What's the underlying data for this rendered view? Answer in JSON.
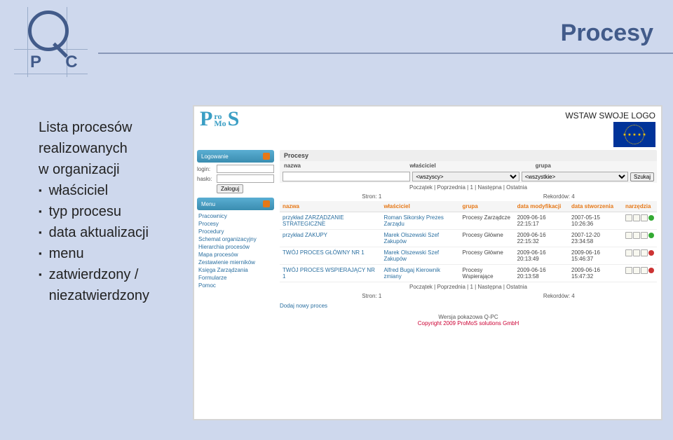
{
  "page": {
    "title": "Procesy",
    "logo_letters": "P C"
  },
  "sidebar": {
    "heading_line1": "Lista procesów",
    "heading_line2": "realizowanych",
    "heading_line3": "w organizacji",
    "items": [
      {
        "label": "właściciel"
      },
      {
        "label": "typ procesu"
      },
      {
        "label": "data aktualizacji"
      },
      {
        "label": "menu"
      },
      {
        "label": "zatwierdzony / niezatwierdzony"
      }
    ]
  },
  "app": {
    "logo": {
      "p": "P",
      "ro": "ro",
      "mo": "Mo",
      "s": "S"
    },
    "header": {
      "wstaw": "WSTAW SWOJE LOGO"
    },
    "login": {
      "bar": "Logowanie",
      "login_label": "login:",
      "haslo_label": "hasło:",
      "button": "Zaloguj"
    },
    "menu": {
      "bar": "Menu",
      "items": [
        "Pracownicy",
        "Procesy",
        "Procedury",
        "Schemat organizacyjny",
        "Hierarchia procesów",
        "Mapa procesów",
        "Zestawienie mierników",
        "Księga Zarządzania",
        "Formularze",
        "Pomoc"
      ]
    },
    "section": {
      "title": "Procesy",
      "cols": [
        "nazwa",
        "właściciel",
        "grupa"
      ],
      "wszyscy": "<wszyscy>",
      "wszystkie": "<wszystkie>",
      "szukaj": "Szukaj",
      "pager_line": "Początek | Poprzednia | 1 | Następna | Ostatnia",
      "stron": "Stron: 1",
      "rekordow": "Rekordów: 4",
      "th": [
        "nazwa",
        "właściciel",
        "grupa",
        "data modyfikacji",
        "data stworzenia",
        "narzędzia"
      ],
      "rows": [
        {
          "nazwa": "przykład ZARZĄDZANIE STRATEGICZNE",
          "wlasciciel": "Roman Sikorsky Prezes Zarządu",
          "grupa": "Procesy Zarządcze",
          "mod": "2009-06-16 22:15:17",
          "stw": "2007-05-15 10:26:36",
          "status": "green"
        },
        {
          "nazwa": "przykład ZAKUPY",
          "wlasciciel": "Marek Olszewski Szef Zakupów",
          "grupa": "Procesy Główne",
          "mod": "2009-06-16 22:15:32",
          "stw": "2007-12-20 23:34:58",
          "status": "green"
        },
        {
          "nazwa": "TWÓJ PROCES GŁÓWNY NR 1",
          "wlasciciel": "Marek Olszewski Szef Zakupów",
          "grupa": "Procesy Główne",
          "mod": "2009-06-16 20:13:49",
          "stw": "2009-06-16 15:46:37",
          "status": "red"
        },
        {
          "nazwa": "TWÓJ PROCES WSPIERAJĄCY NR 1",
          "wlasciciel": "Alfred Bugaj Kierownik zmiany",
          "grupa": "Procesy Wspierające",
          "mod": "2009-06-16 20:13:58",
          "stw": "2009-06-16 15:47:32",
          "status": "red"
        }
      ],
      "dodaj": "Dodaj nowy proces"
    },
    "footer": {
      "line1": "Wersja pokazowa Q-PC",
      "line2": "Copyright 2009 ProMoS solutions GmbH"
    }
  }
}
